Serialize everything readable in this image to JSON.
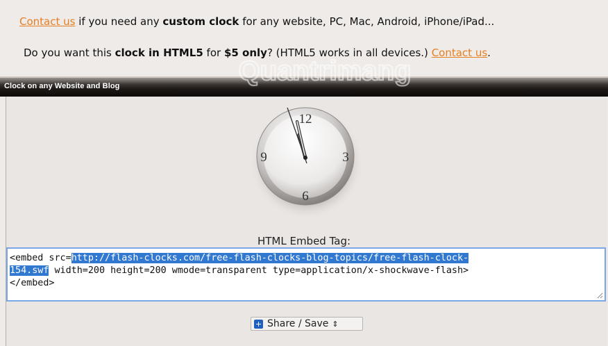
{
  "notice": {
    "line1": {
      "contact_link": "Contact us",
      "text_a": " if you need any ",
      "bold": "custom clock",
      "text_b": " for any website, PC, Mac, Android, iPhone/iPad..."
    },
    "line2": {
      "text_a": "Do you want this ",
      "bold_a": "clock in HTML5",
      "text_b": " for ",
      "bold_b": "$5 only",
      "text_c": "? (HTML5 works in all devices.) ",
      "contact_link": "Contact us",
      "text_d": "."
    }
  },
  "watermark": "Quantrimang",
  "title_bar": "Clock on any Website and Blog",
  "clock": {
    "numbers": [
      "12",
      "3",
      "6",
      "9"
    ]
  },
  "embed": {
    "label": "HTML Embed Tag:",
    "prefix": "<embed src=",
    "selected_1": "http://flash-clocks.com/free-flash-clocks-blog-topics/free-flash-clock-",
    "selected_2": "154.swf",
    "suffix": " width=200 height=200 wmode=transparent type=application/x-shockwave-flash>",
    "closing": "</embed>"
  },
  "share": {
    "label": "Share / Save",
    "caret": "⇕"
  },
  "colors": {
    "link": "#e67e22",
    "selection": "#3178d1",
    "focus_border": "#7aa7e6",
    "background": "#efebe8"
  }
}
